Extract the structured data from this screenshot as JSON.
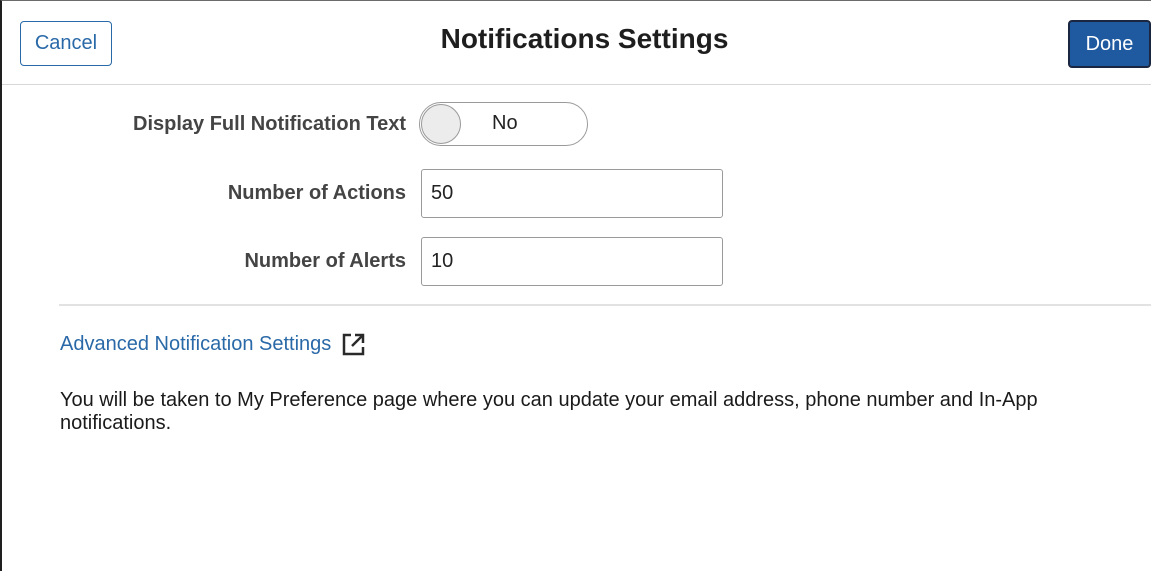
{
  "header": {
    "title": "Notifications Settings",
    "cancel_label": "Cancel",
    "done_label": "Done"
  },
  "form": {
    "display_full_text": {
      "label": "Display Full Notification Text",
      "value": "No"
    },
    "number_of_actions": {
      "label": "Number of Actions",
      "value": "50"
    },
    "number_of_alerts": {
      "label": "Number of Alerts",
      "value": "10"
    }
  },
  "advanced": {
    "link_label": "Advanced Notification Settings",
    "icon": "external-link-icon",
    "info_text": "You will be taken to My Preference page where you can update your email address, phone number and In-App notifications."
  },
  "colors": {
    "accent": "#2a69a8",
    "primary_button": "#1f5aa0"
  }
}
